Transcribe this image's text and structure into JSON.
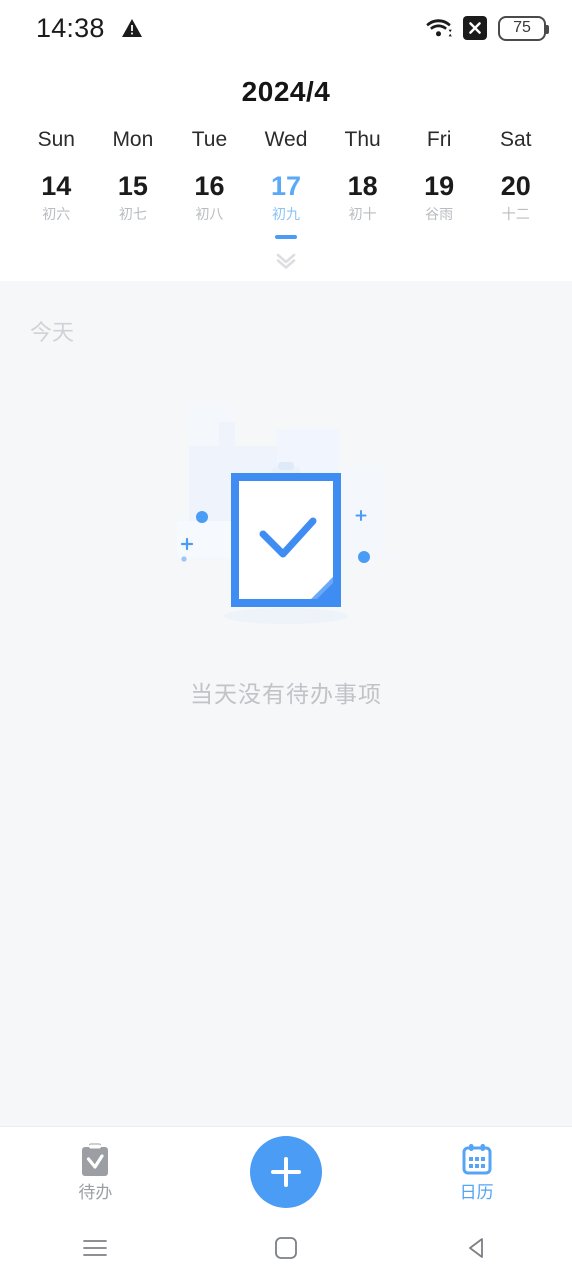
{
  "status_bar": {
    "time": "14:38",
    "warning_icon": "warning-triangle-icon",
    "wifi_icon": "wifi-icon",
    "x_badge_icon": "x-badge-icon",
    "battery_level": "75"
  },
  "calendar": {
    "month_title": "2024/4",
    "weekdays": [
      "Sun",
      "Mon",
      "Tue",
      "Wed",
      "Thu",
      "Fri",
      "Sat"
    ],
    "days": [
      {
        "num": "14",
        "lunar": "初六",
        "selected": false
      },
      {
        "num": "15",
        "lunar": "初七",
        "selected": false
      },
      {
        "num": "16",
        "lunar": "初八",
        "selected": false
      },
      {
        "num": "17",
        "lunar": "初九",
        "selected": true
      },
      {
        "num": "18",
        "lunar": "初十",
        "selected": false
      },
      {
        "num": "19",
        "lunar": "谷雨",
        "selected": false
      },
      {
        "num": "20",
        "lunar": "十二",
        "selected": false
      }
    ],
    "expand_icon": "chevron-double-down-icon",
    "accent_color": "#4a9cf5",
    "selected_text_color": "#5aa9f7"
  },
  "content": {
    "today_label": "今天",
    "empty_illustration": "clipboard-check-illustration",
    "empty_text": "当天没有待办事项",
    "background_color": "#f6f7f8"
  },
  "tabbar": {
    "todo": {
      "label": "待办",
      "icon": "clipboard-check-icon",
      "active": false
    },
    "add": {
      "label": "",
      "icon": "plus-icon"
    },
    "calendar": {
      "label": "日历",
      "icon": "calendar-icon",
      "active": true
    }
  },
  "navbar": {
    "recents_icon": "menu-icon",
    "home_icon": "home-square-icon",
    "back_icon": "back-triangle-icon"
  }
}
